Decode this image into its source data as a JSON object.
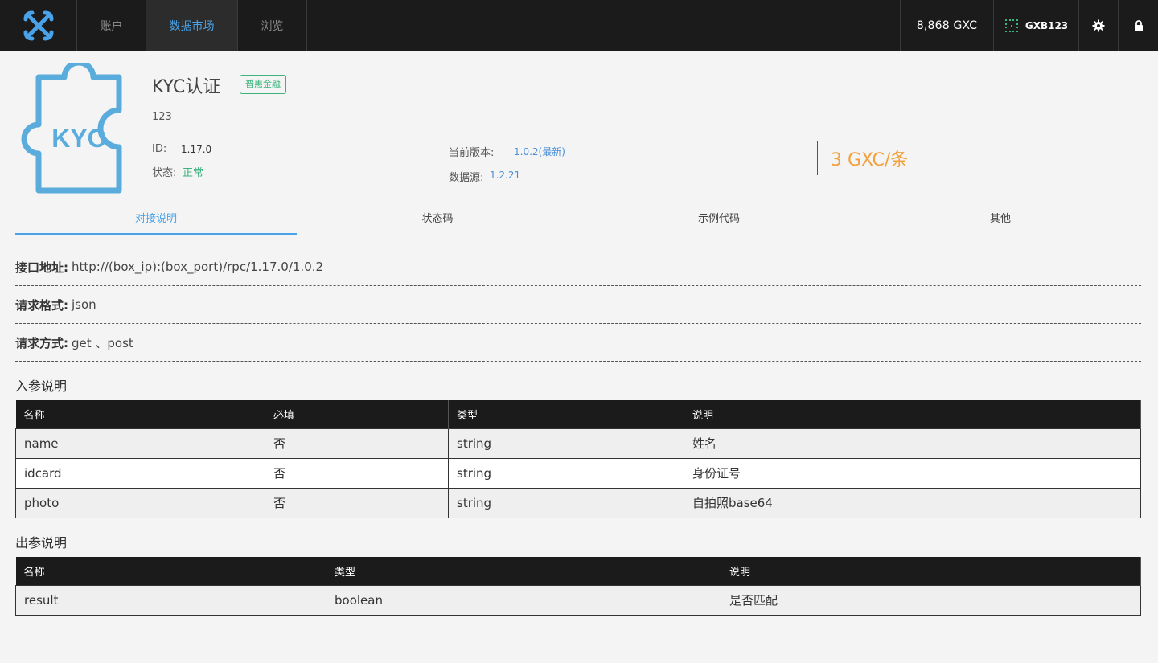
{
  "nav": {
    "items": [
      {
        "label": "账户",
        "active": false
      },
      {
        "label": "数据市场",
        "active": true
      },
      {
        "label": "浏览",
        "active": false
      }
    ],
    "balance": "8,868 GXC",
    "account_name": "GXB123",
    "icons": {
      "logo": "gxchain-x-logo",
      "account": "account-dots-icon",
      "settings": "gear-icon",
      "lock": "lock-icon"
    }
  },
  "product": {
    "logo_text": "KYC",
    "title": "KYC认证",
    "tag": "普惠金融",
    "description": "123",
    "id_label": "ID:",
    "id_value": "1.17.0",
    "status_label": "状态:",
    "status_value": "正常",
    "version_label": "当前版本:",
    "version_value": "1.0.2(最新)",
    "source_label": "数据源:",
    "source_value": "1.2.21",
    "price": "3 GXC/条"
  },
  "tabs": [
    {
      "label": "对接说明",
      "active": true
    },
    {
      "label": "状态码",
      "active": false
    },
    {
      "label": "示例代码",
      "active": false
    },
    {
      "label": "其他",
      "active": false
    }
  ],
  "api": {
    "address_label": "接口地址:",
    "address_value": "http://(box_ip):(box_port)/rpc/1.17.0/1.0.2",
    "format_label": "请求格式:",
    "format_value": "json",
    "method_label": "请求方式:",
    "method_value": "get 、post"
  },
  "input_params": {
    "title": "入参说明",
    "headers": [
      "名称",
      "必填",
      "类型",
      "说明"
    ],
    "rows": [
      [
        "name",
        "否",
        "string",
        "姓名"
      ],
      [
        "idcard",
        "否",
        "string",
        "身份证号"
      ],
      [
        "photo",
        "否",
        "string",
        "自拍照base64"
      ]
    ]
  },
  "output_params": {
    "title": "出参说明",
    "headers": [
      "名称",
      "类型",
      "说明"
    ],
    "rows": [
      [
        "result",
        "boolean",
        "是否匹配"
      ]
    ]
  },
  "colors": {
    "accent": "#4aa3e8",
    "price": "#f2a13d",
    "success": "#3db37d",
    "nav_bg": "#1b1b1b"
  }
}
